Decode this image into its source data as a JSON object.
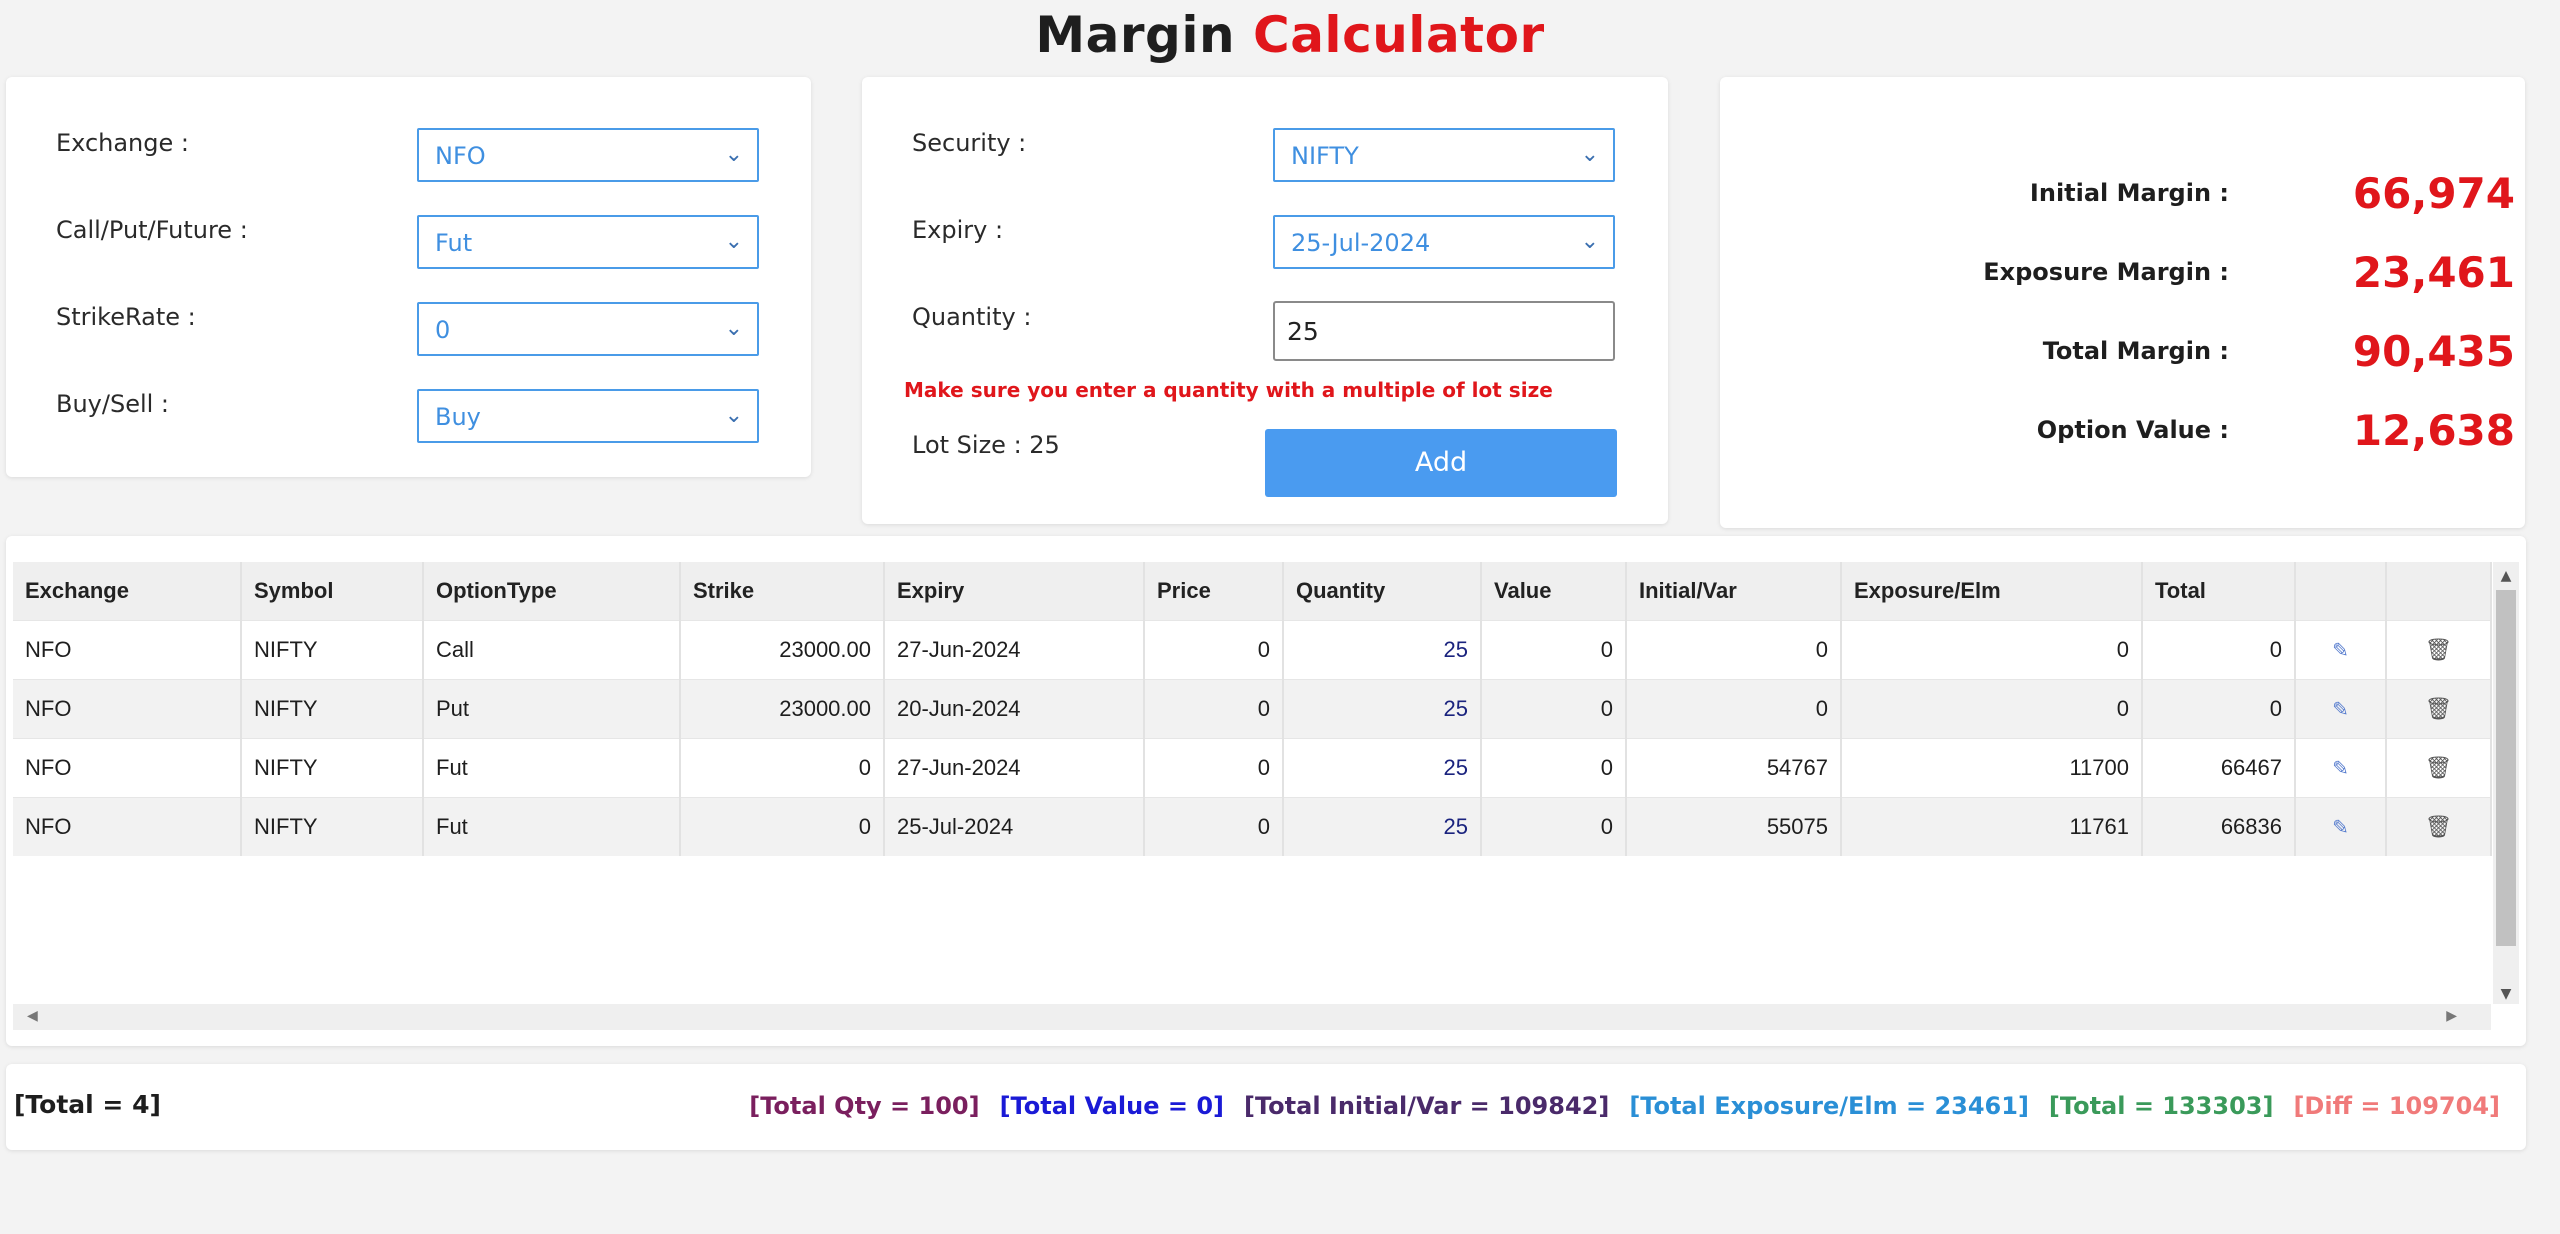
{
  "header": {
    "title_part1": "Margin",
    "title_part2": "Calculator"
  },
  "form_left": {
    "exchange_label": "Exchange :",
    "exchange_value": "NFO",
    "cpf_label": "Call/Put/Future :",
    "cpf_value": "Fut",
    "strike_label": "StrikeRate :",
    "strike_value": "0",
    "buysell_label": "Buy/Sell :",
    "buysell_value": "Buy"
  },
  "form_right": {
    "security_label": "Security :",
    "security_value": "NIFTY",
    "expiry_label": "Expiry :",
    "expiry_value": "25-Jul-2024",
    "quantity_label": "Quantity :",
    "quantity_value": "25",
    "warning": "Make sure you enter a quantity with a multiple of lot size",
    "lot_size": "Lot Size : 25",
    "add_label": "Add"
  },
  "summary": [
    {
      "label": "Initial Margin :",
      "value": "66,974"
    },
    {
      "label": "Exposure Margin :",
      "value": "23,461"
    },
    {
      "label": "Total Margin :",
      "value": "90,435"
    },
    {
      "label": "Option Value :",
      "value": "12,638"
    }
  ],
  "table": {
    "headers": [
      "Exchange",
      "Symbol",
      "OptionType",
      "Strike",
      "Expiry",
      "Price",
      "Quantity",
      "Value",
      "Initial/Var",
      "Exposure/Elm",
      "Total",
      "",
      ""
    ],
    "rows": [
      [
        "NFO",
        "NIFTY",
        "Call",
        "23000.00",
        "27-Jun-2024",
        "0",
        "25",
        "0",
        "0",
        "0",
        "0"
      ],
      [
        "NFO",
        "NIFTY",
        "Put",
        "23000.00",
        "20-Jun-2024",
        "0",
        "25",
        "0",
        "0",
        "0",
        "0"
      ],
      [
        "NFO",
        "NIFTY",
        "Fut",
        "0",
        "27-Jun-2024",
        "0",
        "25",
        "0",
        "54767",
        "11700",
        "66467"
      ],
      [
        "NFO",
        "NIFTY",
        "Fut",
        "0",
        "25-Jul-2024",
        "0",
        "25",
        "0",
        "55075",
        "11761",
        "66836"
      ]
    ]
  },
  "totals": {
    "count": "[Total = 4]",
    "qty": "[Total Qty = 100]",
    "value": "[Total Value = 0]",
    "initial": "[Total Initial/Var = 109842]",
    "exposure": "[Total Exposure/Elm = 23461]",
    "total": "[Total = 133303]",
    "diff": "[Diff = 109704]"
  },
  "colors": {
    "accent_red": "#e0161b",
    "accent_blue": "#4a9bf0",
    "qty_color": "#7a1f5e",
    "value_color": "#1a1ad6",
    "initial_color": "#4a2a6a",
    "exposure_color": "#2a8fd6",
    "total_color": "#3a9a5a",
    "diff_color": "#f07a7a"
  }
}
